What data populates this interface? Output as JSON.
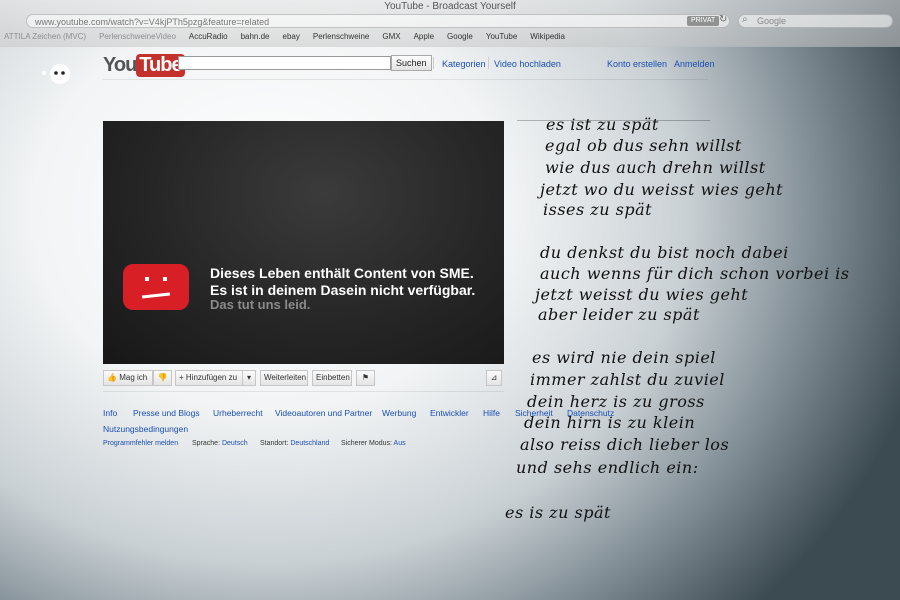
{
  "browser": {
    "window_title": "YouTube - Broadcast Yourself",
    "url": "www.youtube.com/watch?v=V4kjPTh5pzg&feature=related",
    "private_badge": "PRIVAT",
    "search_placeholder": "Google",
    "bookmarks": [
      "ATTILA Zeichen (MVC)",
      "PerlenschweineVideo",
      "AccuRadio",
      "bahn.de",
      "ebay",
      "Perlenschweine",
      "GMX",
      "Apple",
      "Google",
      "YouTube",
      "Wikipedia"
    ]
  },
  "header": {
    "logo_you": "You",
    "logo_tube": "Tube",
    "search_button": "Suchen",
    "nav": [
      "Kategorien",
      "Video hochladen",
      "Konto erstellen",
      "Anmelden"
    ]
  },
  "player": {
    "error_line1": "Dieses Leben enthält Content von SME.",
    "error_line2": "Es ist in deinem Dasein nicht verfügbar.",
    "error_line3": "Das tut uns leid."
  },
  "actions": {
    "like": "Mag ich",
    "add": "Hinzufügen zu",
    "share": "Weiterleiten",
    "embed": "Einbetten"
  },
  "footer": {
    "links": [
      "Info",
      "Presse und Blogs",
      "Urheberrecht",
      "Videoautoren und Partner",
      "Werbung",
      "Entwickler",
      "Hilfe",
      "Sicherheit",
      "Datenschutz",
      "Nutzungsbedingungen"
    ],
    "report_bug": "Programmfehler melden",
    "language_label": "Sprache:",
    "language_value": "Deutsch",
    "location_label": "Standort:",
    "location_value": "Deutschland",
    "safety_label": "Sicherer Modus:",
    "safety_value": "Aus"
  },
  "lyrics": [
    "es ist zu spät",
    "egal ob dus sehn willst",
    "wie dus auch drehn willst",
    "jetzt wo du weisst wies geht",
    "isses zu spät",
    "du denkst du bist noch dabei",
    "auch wenns für dich schon vorbei is",
    "jetzt weisst du wies geht",
    "aber leider zu spät",
    "es wird nie dein spiel",
    "immer zahlst du zuviel",
    "dein herz is zu gross",
    "dein hirn is zu klein",
    "also reiss dich lieber los",
    "und sehs endlich ein:",
    "es is zu spät"
  ]
}
